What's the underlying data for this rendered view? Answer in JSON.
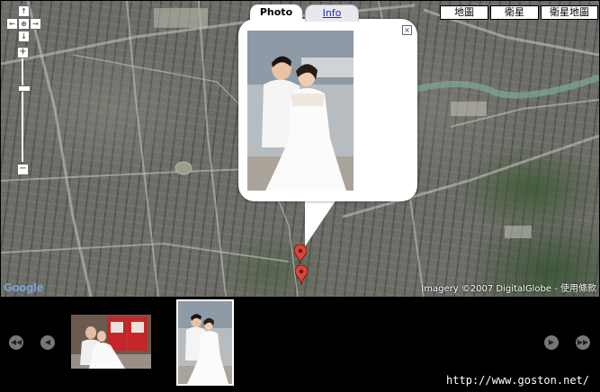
{
  "map": {
    "controls": {
      "pan_up": "↑",
      "pan_left": "←",
      "pan_center": "⊕",
      "pan_right": "→",
      "pan_down": "↓",
      "zoom_in": "+",
      "zoom_out": "−"
    },
    "map_types": [
      "地圖",
      "衛星",
      "衛星地圖"
    ],
    "logo_text": "Google",
    "attribution": "Imagery ©2007 DigitalGlobe - 使用條款",
    "marker_color": "#d9453a"
  },
  "info_window": {
    "tabs": {
      "photo": "Photo",
      "info": "Info"
    },
    "close_icon": "×"
  },
  "filmstrip": {
    "nav": {
      "first": "◀◀",
      "prev": "◀",
      "next": "▶",
      "last": "▶▶"
    },
    "url": "http://www.goston.net/"
  }
}
